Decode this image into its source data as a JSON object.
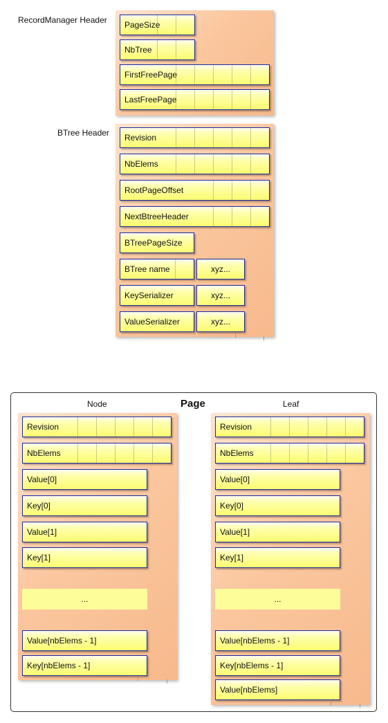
{
  "record_manager": {
    "label": "RecordManager Header",
    "fields": [
      "PageSize",
      "NbTree",
      "FirstFreePage",
      "LastFreePage"
    ]
  },
  "btree_header": {
    "label": "BTree Header",
    "fields": [
      "Revision",
      "NbElems",
      "RootPageOffset",
      "NextBtreeHeader",
      "BTreePageSize",
      "BTree name",
      "KeySerializer",
      "ValueSerializer"
    ],
    "extra": [
      "xyz...",
      "xyz...",
      "xyz..."
    ]
  },
  "page": {
    "title": "Page",
    "node": {
      "label": "Node",
      "fields": [
        "Revision",
        "NbElems",
        "Value[0]",
        "Key[0]",
        "Value[1]",
        "Key[1]",
        "...",
        "Value[nbElems - 1]",
        "Key[nbElems - 1]"
      ]
    },
    "leaf": {
      "label": "Leaf",
      "fields": [
        "Revision",
        "NbElems",
        "Value[0]",
        "Key[0]",
        "Value[1]",
        "Key[1]",
        "...",
        "Value[nbElems - 1]",
        "Key[nbElems - 1]",
        "Value[nbElems]"
      ]
    }
  }
}
